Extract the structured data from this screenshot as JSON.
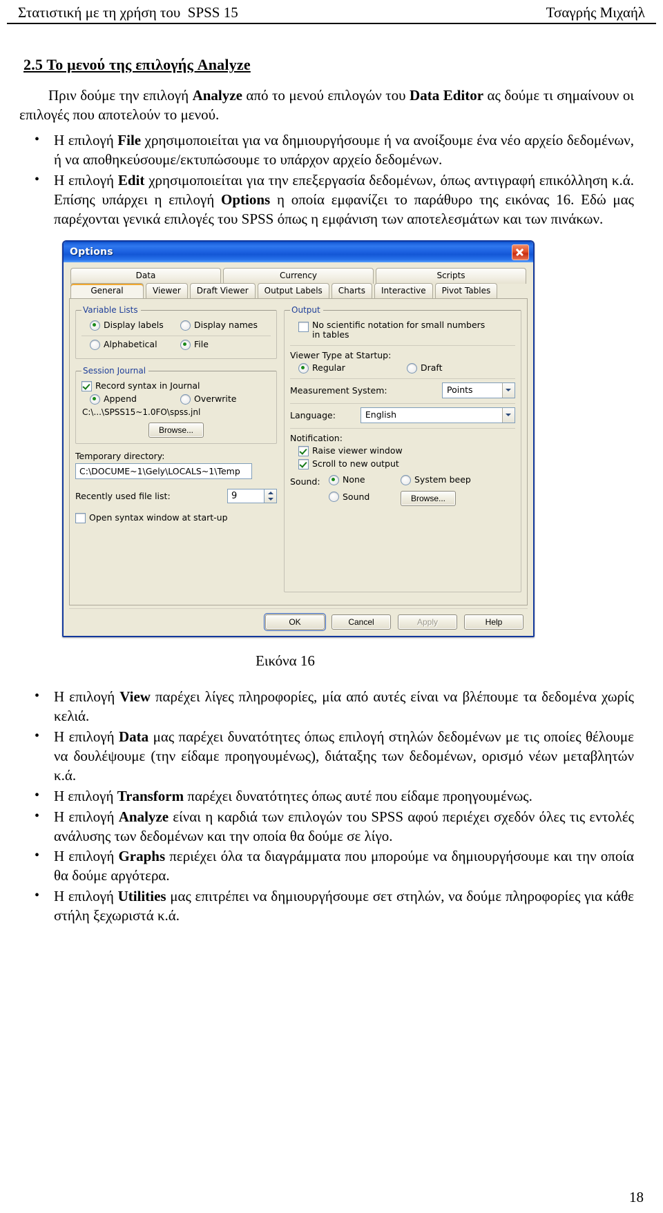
{
  "header": {
    "left": "Στατιστική με τη χρήση του  SPSS 15",
    "right": "Τσαγρής Μιχαήλ"
  },
  "section": {
    "title": "2.5 Το μενού της επιλογής Analyze"
  },
  "intro": {
    "p1_a": "Πριν δούμε την επιλογή ",
    "p1_b": "Analyze",
    "p1_c": " από το μενού επιλογών του ",
    "p1_d": "Data Editor",
    "p1_e": " ας δούμε τι σημαίνουν οι επιλογές που αποτελούν το μενού."
  },
  "bullets_top": [
    {
      "a": "Η επιλογή ",
      "b": "File",
      "c": " χρησιμοποιείται για να δημιουργήσουμε ή να ανοίξουμε ένα νέο αρχείο δεδομένων, ή να αποθηκεύσουμε/εκτυπώσουμε το υπάρχον αρχείο δεδομένων."
    },
    {
      "a": "Η επιλογή ",
      "b": "Edit",
      "c": " χρησιμοποιείται για την επεξεργασία δεδομένων, όπως αντιγραφή επικόλληση κ.ά. Επίσης υπάρχει η επιλογή ",
      "d": "Options",
      "e": " η οποία εμφανίζει το παράθυρο της εικόνας 16. Εδώ μας παρέχονται γενικά επιλογές του SPSS όπως η εμφάνιση των αποτελεσμάτων και των πινάκων."
    }
  ],
  "dialog": {
    "title": "Options",
    "close_icon": "close-icon",
    "tabs_top": [
      "Data",
      "Currency",
      "Scripts"
    ],
    "tabs_second": [
      "General",
      "Viewer",
      "Draft Viewer",
      "Output Labels",
      "Charts",
      "Interactive",
      "Pivot Tables"
    ],
    "selected_tab": "General",
    "variable_lists": {
      "legend": "Variable Lists",
      "options": [
        {
          "label": "Display labels",
          "selected": true
        },
        {
          "label": "Display names",
          "selected": false
        },
        {
          "label": "Alphabetical",
          "selected": false
        },
        {
          "label": "File",
          "selected": true
        }
      ]
    },
    "session_journal": {
      "legend": "Session Journal",
      "record_syntax": {
        "label": "Record syntax in Journal",
        "checked": true
      },
      "mode": [
        {
          "label": "Append",
          "selected": true
        },
        {
          "label": "Overwrite",
          "selected": false
        }
      ],
      "path": "C:\\...\\SPSS15~1.0FO\\spss.jnl",
      "browse_label": "Browse..."
    },
    "temporary_directory": {
      "label": "Temporary directory:",
      "value": "C:\\DOCUME~1\\Gely\\LOCALS~1\\Temp"
    },
    "recently_used": {
      "label": "Recently used file list:",
      "value": "9"
    },
    "open_syntax": {
      "label": "Open syntax window at start-up",
      "checked": false
    },
    "output": {
      "legend": "Output",
      "no_sci_notation": {
        "line1": "No scientific notation for small numbers",
        "line2": "in tables",
        "checked": false
      },
      "viewer_type_label": "Viewer Type at Startup:",
      "viewer_type": [
        {
          "label": "Regular",
          "selected": true
        },
        {
          "label": "Draft",
          "selected": false
        }
      ],
      "measurement_label": "Measurement System:",
      "measurement_value": "Points",
      "language_label": "Language:",
      "language_value": "English",
      "notification_label": "Notification:",
      "raise_viewer": {
        "label": "Raise viewer window",
        "checked": true
      },
      "scroll_new": {
        "label": "Scroll to new output",
        "checked": true
      },
      "sound_label": "Sound:",
      "sound_options": [
        {
          "label": "None",
          "selected": true
        },
        {
          "label": "System beep",
          "selected": false
        },
        {
          "label": "Sound",
          "selected": false
        }
      ],
      "sound_browse_label": "Browse..."
    },
    "footer_buttons": [
      "OK",
      "Cancel",
      "Apply",
      "Help"
    ]
  },
  "figure_caption": "Εικόνα 16",
  "bullets_bottom": [
    {
      "a": "Η επιλογή ",
      "b": "View",
      "c": " παρέχει λίγες πληροφορίες, μία από αυτές είναι να βλέπουμε τα δεδομένα χωρίς κελιά."
    },
    {
      "a": "Η επιλογή ",
      "b": "Data",
      "c": " μας παρέχει δυνατότητες όπως επιλογή στηλών δεδομένων με τις οποίες θέλουμε να δουλέψουμε (την είδαμε προηγουμένως), διάταξης των δεδομένων, ορισμό νέων μεταβλητών κ.ά."
    },
    {
      "a": "Η επιλογή ",
      "b": "Transform",
      "c": " παρέχει δυνατότητες όπως αυτέ που είδαμε προηγουμένως."
    },
    {
      "a": "Η επιλογή ",
      "b": "Analyze",
      "c": " είναι η καρδιά των επιλογών του SPSS αφού περιέχει σχεδόν όλες τις εντολές ανάλυσης των δεδομένων και την οποία θα δούμε σε λίγο."
    },
    {
      "a": "Η επιλογή ",
      "b": "Graphs",
      "c": " περιέχει όλα τα διαγράμματα που μπορούμε να δημιουργήσουμε και την οποία θα δούμε αργότερα."
    },
    {
      "a": "Η επιλογή ",
      "b": "Utilities",
      "c": " μας επιτρέπει να δημιουργήσουμε σετ στηλών, να δούμε πληροφορίες για κάθε στήλη ξεχωριστά κ.ά."
    }
  ],
  "page_number": "18"
}
